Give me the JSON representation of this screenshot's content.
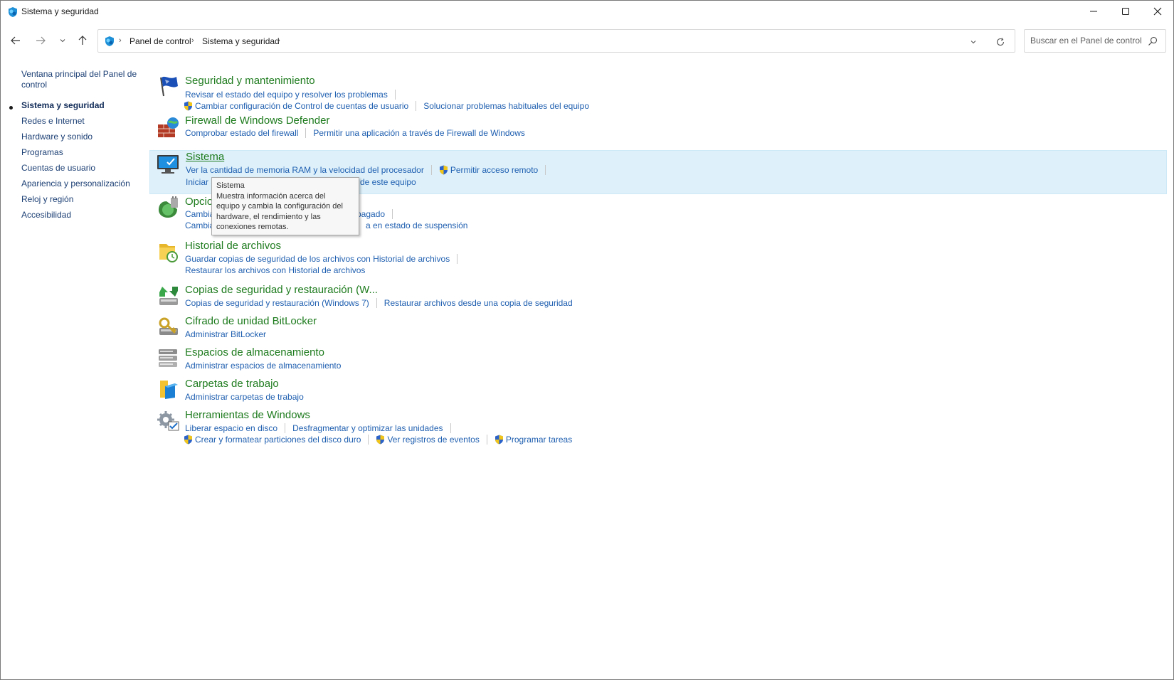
{
  "window": {
    "title": "Sistema y seguridad"
  },
  "nav": {
    "breadcrumbs": [
      "Panel de control",
      "Sistema y seguridad"
    ],
    "search_placeholder": "Buscar en el Panel de control"
  },
  "sidebar": {
    "items": [
      {
        "label": "Ventana principal del Panel de",
        "label2": "control"
      },
      {
        "label": "Sistema y seguridad",
        "current": true
      },
      {
        "label": "Redes e Internet"
      },
      {
        "label": "Hardware y sonido"
      },
      {
        "label": "Programas"
      },
      {
        "label": "Cuentas de usuario"
      },
      {
        "label": "Apariencia y personalización"
      },
      {
        "label": "Reloj y región"
      },
      {
        "label": "Accesibilidad"
      }
    ]
  },
  "sections": {
    "s1": {
      "title": "Seguridad y mantenimiento",
      "l1": "Revisar el estado del equipo y resolver los problemas",
      "l2": "Cambiar configuración de Control de cuentas de usuario",
      "l3": "Solucionar problemas habituales del equipo"
    },
    "s2": {
      "title": "Firewall de Windows Defender",
      "l1": "Comprobar estado del firewall",
      "l2": "Permitir una aplicación a través de Firewall de Windows"
    },
    "s3": {
      "title": "Sistema",
      "l1": "Ver la cantidad de memoria RAM y la velocidad del procesador",
      "l2": "Permitir acceso remoto",
      "l3a": "Iniciar a",
      "l3b": "de este equipo"
    },
    "s4": {
      "title": "Opcio",
      "l1a": "Cambia",
      "l1b": "pagado",
      "l2a": "Cambia",
      "l2b": "a en estado de suspensión"
    },
    "s5": {
      "title": "Historial de archivos",
      "l1": "Guardar copias de seguridad de los archivos con Historial de archivos",
      "l2": "Restaurar los archivos con Historial de archivos"
    },
    "s6": {
      "title": "Copias de seguridad y restauración (W...",
      "l1": "Copias de seguridad y restauración (Windows 7)",
      "l2": "Restaurar archivos desde una copia de seguridad"
    },
    "s7": {
      "title": "Cifrado de unidad BitLocker",
      "l1": "Administrar BitLocker"
    },
    "s8": {
      "title": "Espacios de almacenamiento",
      "l1": "Administrar espacios de almacenamiento"
    },
    "s9": {
      "title": "Carpetas de trabajo",
      "l1": "Administrar carpetas de trabajo"
    },
    "s10": {
      "title": "Herramientas de Windows",
      "l1": "Liberar espacio en disco",
      "l2": "Desfragmentar y optimizar las unidades",
      "l3": "Crear y formatear particiones del disco duro",
      "l4": "Ver registros de eventos",
      "l5": "Programar tareas"
    }
  },
  "tooltip": {
    "title": "Sistema",
    "line1": "Muestra información acerca del",
    "line2": "equipo y cambia la configuración del",
    "line3": "hardware, el rendimiento y las",
    "line4": "conexiones remotas."
  }
}
